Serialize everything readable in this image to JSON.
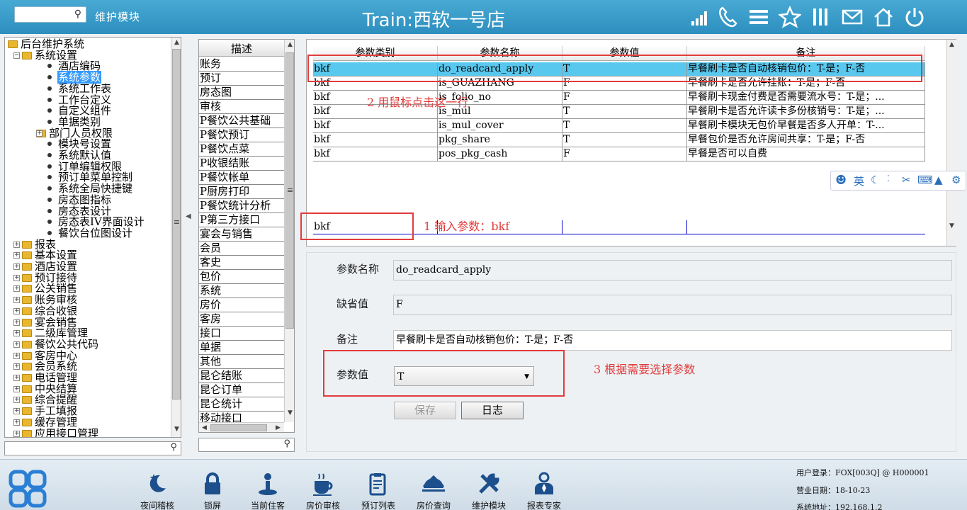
{
  "header": {
    "search_placeholder": "",
    "module_label": "维护模块",
    "title": "Train:西软一号店",
    "icons": [
      "signal-icon",
      "phone-icon",
      "menu-icon",
      "star-icon",
      "columns-icon",
      "mail-icon",
      "home-icon",
      "power-icon"
    ]
  },
  "tree": {
    "items": [
      {
        "label": "后台维护系统",
        "level": 0,
        "kind": "folder",
        "expander": "minus"
      },
      {
        "label": "系统设置",
        "level": 1,
        "kind": "folder",
        "expander": "minus"
      },
      {
        "label": "酒店编码",
        "level": 2,
        "kind": "leaf"
      },
      {
        "label": "系统参数",
        "level": 2,
        "kind": "leaf",
        "selected": true
      },
      {
        "label": "系统工作表",
        "level": 2,
        "kind": "leaf"
      },
      {
        "label": "工作台定义",
        "level": 2,
        "kind": "leaf"
      },
      {
        "label": "自定义组件",
        "level": 2,
        "kind": "leaf"
      },
      {
        "label": "单据类别",
        "level": 2,
        "kind": "leaf"
      },
      {
        "label": "部门人员权限",
        "level": 2,
        "kind": "folder",
        "expander": "plus"
      },
      {
        "label": "模块号设置",
        "level": 2,
        "kind": "leaf"
      },
      {
        "label": "系统默认值",
        "level": 2,
        "kind": "leaf"
      },
      {
        "label": "订单编辑权限",
        "level": 2,
        "kind": "leaf"
      },
      {
        "label": "预订单菜单控制",
        "level": 2,
        "kind": "leaf"
      },
      {
        "label": "系统全局快捷键",
        "level": 2,
        "kind": "leaf"
      },
      {
        "label": "房态图指标",
        "level": 2,
        "kind": "leaf"
      },
      {
        "label": "房态表设计",
        "level": 2,
        "kind": "leaf"
      },
      {
        "label": "房态表IV界面设计",
        "level": 2,
        "kind": "leaf"
      },
      {
        "label": "餐饮台位图设计",
        "level": 2,
        "kind": "leaf"
      },
      {
        "label": "报表",
        "level": 1,
        "kind": "folder",
        "expander": "plus"
      },
      {
        "label": "基本设置",
        "level": 1,
        "kind": "folder",
        "expander": "plus"
      },
      {
        "label": "酒店设置",
        "level": 1,
        "kind": "folder",
        "expander": "plus"
      },
      {
        "label": "预订接待",
        "level": 1,
        "kind": "folder",
        "expander": "plus"
      },
      {
        "label": "公关销售",
        "level": 1,
        "kind": "folder",
        "expander": "plus"
      },
      {
        "label": "账务审核",
        "level": 1,
        "kind": "folder",
        "expander": "plus"
      },
      {
        "label": "综合收银",
        "level": 1,
        "kind": "folder",
        "expander": "plus"
      },
      {
        "label": "宴会销售",
        "level": 1,
        "kind": "folder",
        "expander": "plus"
      },
      {
        "label": "二级库管理",
        "level": 1,
        "kind": "folder",
        "expander": "plus"
      },
      {
        "label": "餐饮公共代码",
        "level": 1,
        "kind": "folder",
        "expander": "plus"
      },
      {
        "label": "客房中心",
        "level": 1,
        "kind": "folder",
        "expander": "plus"
      },
      {
        "label": "会员系统",
        "level": 1,
        "kind": "folder",
        "expander": "plus"
      },
      {
        "label": "电话管理",
        "level": 1,
        "kind": "folder",
        "expander": "plus"
      },
      {
        "label": "中央结算",
        "level": 1,
        "kind": "folder",
        "expander": "plus"
      },
      {
        "label": "综合提醒",
        "level": 1,
        "kind": "folder",
        "expander": "plus"
      },
      {
        "label": "手工填报",
        "level": 1,
        "kind": "folder",
        "expander": "plus"
      },
      {
        "label": "缓存管理",
        "level": 1,
        "kind": "folder",
        "expander": "plus"
      },
      {
        "label": "应用接口管理",
        "level": 1,
        "kind": "folder",
        "expander": "plus"
      }
    ]
  },
  "category_list": {
    "header": "描述",
    "items": [
      "账务",
      "预订",
      "房态图",
      "审核",
      "P餐饮公共基础",
      "P餐饮预订",
      "P餐饮点菜",
      "P收银结账",
      "P餐饮帐单",
      "P厨房打印",
      "P餐饮统计分析",
      "P第三方接口",
      "宴会与销售",
      "会员",
      "客史",
      "包价",
      "系统",
      "房价",
      "客房",
      "接口",
      "单据",
      "其他",
      "昆仑结账",
      "昆仑订单",
      "昆仑统计",
      "移动接口"
    ]
  },
  "grid": {
    "columns": [
      "参数类别",
      "参数名称",
      "参数值",
      "备注"
    ],
    "rows": [
      [
        "bkf",
        "do_readcard_apply",
        "T",
        "早餐刷卡是否自动核销包价：T-是；F-否"
      ],
      [
        "bkf",
        "is_GUAZHANG",
        "F",
        "早餐刷卡是否允许挂账：T-是；F-否"
      ],
      [
        "bkf",
        "is_folio_no",
        "F",
        "早餐刷卡现金付费是否需要流水号：T-是；..."
      ],
      [
        "bkf",
        "is_mul",
        "T",
        "早餐刷卡是否允许读卡多份核销号：T-是；..."
      ],
      [
        "bkf",
        "is_mul_cover",
        "T",
        "早餐刷卡模块无包价早餐是否多人开单：T-..."
      ],
      [
        "bkf",
        "pkg_share",
        "T",
        "早餐包价是否允许房间共享：T-是；F-否"
      ],
      [
        "bkf",
        "pos_pkg_cash",
        "F",
        "早餐是否可以自费"
      ]
    ],
    "selected_row": 0,
    "filter_value": "bkf"
  },
  "annotations": {
    "step1": "1 输入参数：bkf",
    "step2": "2 用鼠标点击这一行",
    "step3": "3 根据需要选择参数"
  },
  "detail": {
    "name_label": "参数名称",
    "name_value": "do_readcard_apply",
    "default_label": "缺省值",
    "default_value": "F",
    "remark_label": "备注",
    "remark_value": "早餐刷卡是否自动核销包价：T-是；F-否",
    "value_label": "参数值",
    "value_selected": "T",
    "save_label": "保存",
    "log_label": "日志"
  },
  "ime_toolbar": {
    "lang": "英",
    "icons": [
      "user-icon",
      "moon-icon",
      "dots-icon",
      "scissors-icon",
      "keyboard-icon",
      "shirt-icon",
      "gear-icon"
    ]
  },
  "footer": {
    "tools": [
      {
        "label": "夜间稽核",
        "icon": "moon-star-icon"
      },
      {
        "label": "锁屏",
        "icon": "lock-icon"
      },
      {
        "label": "当前住客",
        "icon": "guest-icon"
      },
      {
        "label": "房价审核",
        "icon": "coffee-icon"
      },
      {
        "label": "预订列表",
        "icon": "clipboard-icon"
      },
      {
        "label": "房价查询",
        "icon": "dish-icon"
      },
      {
        "label": "维护模块",
        "icon": "tools-icon"
      },
      {
        "label": "报表专家",
        "icon": "expert-icon"
      }
    ],
    "user_login": "用户登录：FOX[003Q] @ H000001",
    "business_date": "营业日期：18-10-23",
    "system_address": "系统地址：192.168.1.2"
  },
  "colors": {
    "header": "#3a9dcb",
    "selected_row": "#59c8ee",
    "annotation": "#e23b3b",
    "tree_selection": "#3399ff"
  }
}
